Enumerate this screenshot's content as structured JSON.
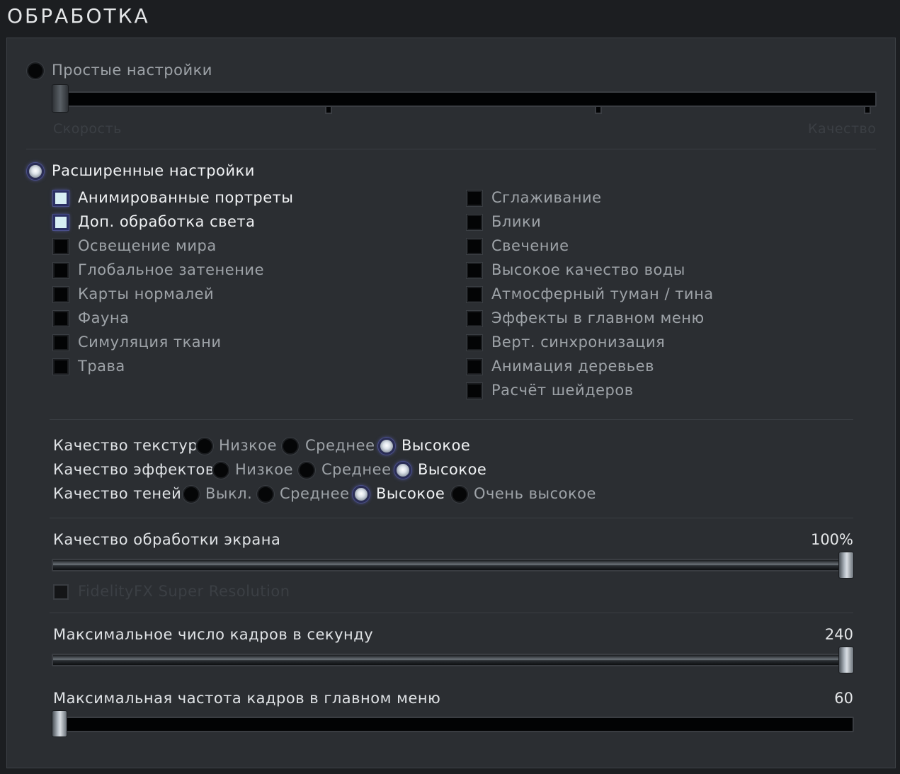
{
  "title": "ОБРАБОТКА",
  "simple": {
    "label": "Простые настройки",
    "left_label": "Скорость",
    "right_label": "Качество",
    "level": 0
  },
  "advanced": {
    "label": "Расширенные настройки",
    "left": [
      {
        "label": "Анимированные портреты",
        "checked": true
      },
      {
        "label": "Доп. обработка света",
        "checked": true
      },
      {
        "label": "Освещение мира",
        "checked": false
      },
      {
        "label": "Глобальное затенение",
        "checked": false
      },
      {
        "label": "Карты нормалей",
        "checked": false
      },
      {
        "label": "Фауна",
        "checked": false
      },
      {
        "label": "Симуляция ткани",
        "checked": false
      },
      {
        "label": "Трава",
        "checked": false
      }
    ],
    "right": [
      {
        "label": "Сглаживание",
        "checked": false
      },
      {
        "label": "Блики",
        "checked": false
      },
      {
        "label": "Свечение",
        "checked": false
      },
      {
        "label": "Высокое качество воды",
        "checked": false
      },
      {
        "label": "Атмосферный туман / тина",
        "checked": false
      },
      {
        "label": "Эффекты в главном меню",
        "checked": false
      },
      {
        "label": "Верт. синхронизация",
        "checked": false
      },
      {
        "label": "Анимация деревьев",
        "checked": false
      },
      {
        "label": "Расчёт шейдеров",
        "checked": false
      }
    ]
  },
  "quality": {
    "texture": {
      "label": "Качество текстур",
      "options": [
        "Низкое",
        "Среднее",
        "Высокое"
      ],
      "selected": "Высокое"
    },
    "effects": {
      "label": "Качество эффектов",
      "options": [
        "Низкое",
        "Среднее",
        "Высокое"
      ],
      "selected": "Высокое"
    },
    "shadows": {
      "label": "Качество теней",
      "options": [
        "Выкл.",
        "Среднее",
        "Высокое",
        "Очень высокое"
      ],
      "selected": "Высокое"
    }
  },
  "screen": {
    "label": "Качество обработки экрана",
    "value_text": "100%",
    "fraction": 1.0,
    "fsr_label": "FidelityFX Super Resolution",
    "fsr_checked": false
  },
  "fps": {
    "label": "Максимальное число кадров в секунду",
    "value_text": "240",
    "fraction": 1.0
  },
  "menu_fps": {
    "label": "Максимальная частота кадров в главном меню",
    "value_text": "60",
    "fraction": 0.0
  }
}
